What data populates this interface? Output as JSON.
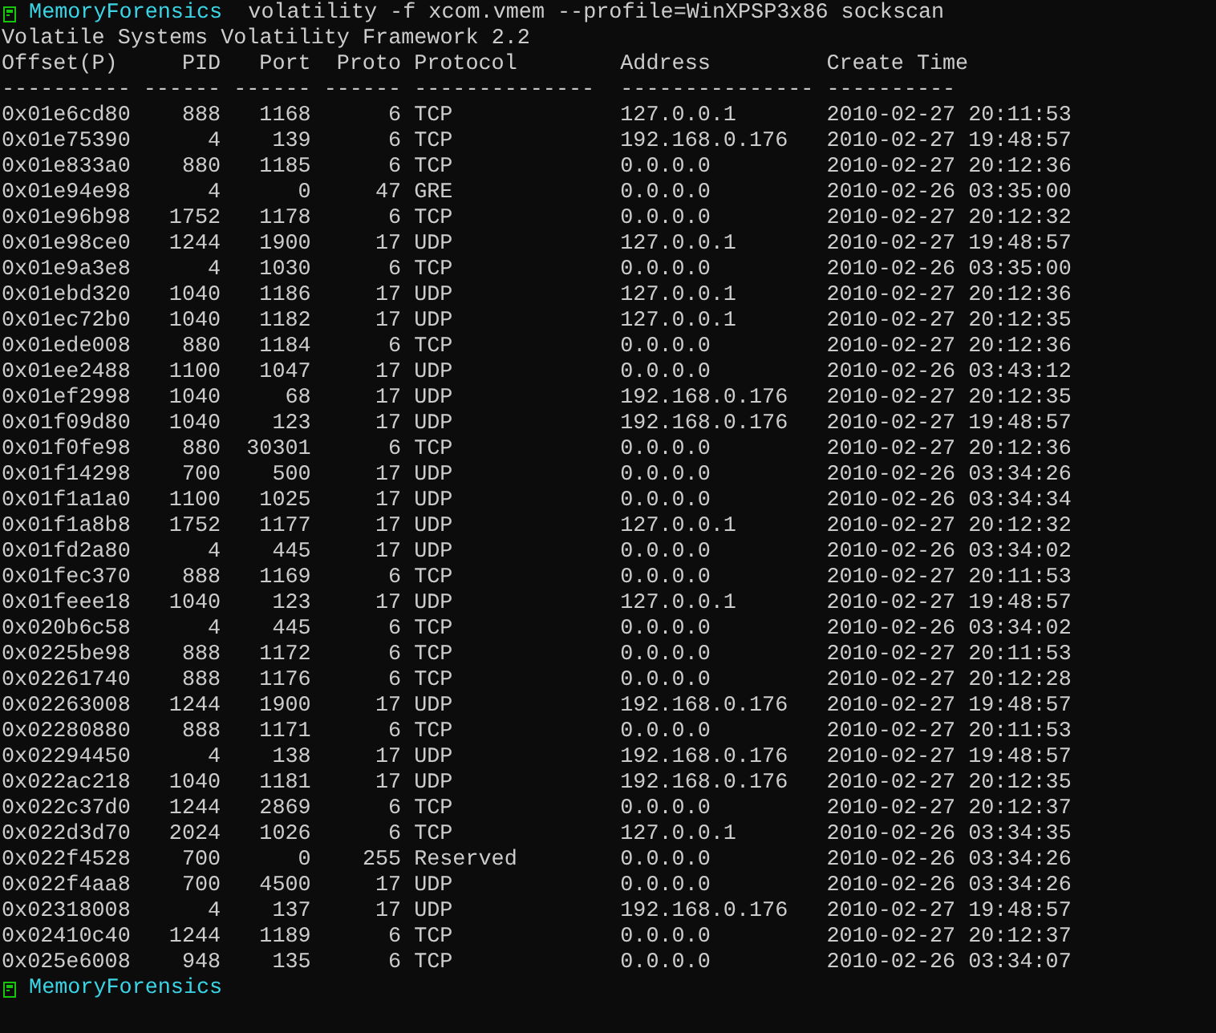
{
  "prompt": {
    "host": "MemoryForensics",
    "command": "volatility -f xcom.vmem --profile=WinXPSP3x86 sockscan"
  },
  "banner": "Volatile Systems Volatility Framework 2.2",
  "columns": [
    "Offset(P)",
    "PID",
    "Port",
    "Proto",
    "Protocol",
    "Address",
    "Create Time"
  ],
  "separator": [
    "----------",
    "------",
    "------",
    "------",
    "--------------",
    "---------------",
    "----------"
  ],
  "rows": [
    [
      "0x01e6cd80",
      "888",
      "1168",
      "6",
      "TCP",
      "127.0.0.1",
      "2010-02-27 20:11:53"
    ],
    [
      "0x01e75390",
      "4",
      "139",
      "6",
      "TCP",
      "192.168.0.176",
      "2010-02-27 19:48:57"
    ],
    [
      "0x01e833a0",
      "880",
      "1185",
      "6",
      "TCP",
      "0.0.0.0",
      "2010-02-27 20:12:36"
    ],
    [
      "0x01e94e98",
      "4",
      "0",
      "47",
      "GRE",
      "0.0.0.0",
      "2010-02-26 03:35:00"
    ],
    [
      "0x01e96b98",
      "1752",
      "1178",
      "6",
      "TCP",
      "0.0.0.0",
      "2010-02-27 20:12:32"
    ],
    [
      "0x01e98ce0",
      "1244",
      "1900",
      "17",
      "UDP",
      "127.0.0.1",
      "2010-02-27 19:48:57"
    ],
    [
      "0x01e9a3e8",
      "4",
      "1030",
      "6",
      "TCP",
      "0.0.0.0",
      "2010-02-26 03:35:00"
    ],
    [
      "0x01ebd320",
      "1040",
      "1186",
      "17",
      "UDP",
      "127.0.0.1",
      "2010-02-27 20:12:36"
    ],
    [
      "0x01ec72b0",
      "1040",
      "1182",
      "17",
      "UDP",
      "127.0.0.1",
      "2010-02-27 20:12:35"
    ],
    [
      "0x01ede008",
      "880",
      "1184",
      "6",
      "TCP",
      "0.0.0.0",
      "2010-02-27 20:12:36"
    ],
    [
      "0x01ee2488",
      "1100",
      "1047",
      "17",
      "UDP",
      "0.0.0.0",
      "2010-02-26 03:43:12"
    ],
    [
      "0x01ef2998",
      "1040",
      "68",
      "17",
      "UDP",
      "192.168.0.176",
      "2010-02-27 20:12:35"
    ],
    [
      "0x01f09d80",
      "1040",
      "123",
      "17",
      "UDP",
      "192.168.0.176",
      "2010-02-27 19:48:57"
    ],
    [
      "0x01f0fe98",
      "880",
      "30301",
      "6",
      "TCP",
      "0.0.0.0",
      "2010-02-27 20:12:36"
    ],
    [
      "0x01f14298",
      "700",
      "500",
      "17",
      "UDP",
      "0.0.0.0",
      "2010-02-26 03:34:26"
    ],
    [
      "0x01f1a1a0",
      "1100",
      "1025",
      "17",
      "UDP",
      "0.0.0.0",
      "2010-02-26 03:34:34"
    ],
    [
      "0x01f1a8b8",
      "1752",
      "1177",
      "17",
      "UDP",
      "127.0.0.1",
      "2010-02-27 20:12:32"
    ],
    [
      "0x01fd2a80",
      "4",
      "445",
      "17",
      "UDP",
      "0.0.0.0",
      "2010-02-26 03:34:02"
    ],
    [
      "0x01fec370",
      "888",
      "1169",
      "6",
      "TCP",
      "0.0.0.0",
      "2010-02-27 20:11:53"
    ],
    [
      "0x01feee18",
      "1040",
      "123",
      "17",
      "UDP",
      "127.0.0.1",
      "2010-02-27 19:48:57"
    ],
    [
      "0x020b6c58",
      "4",
      "445",
      "6",
      "TCP",
      "0.0.0.0",
      "2010-02-26 03:34:02"
    ],
    [
      "0x0225be98",
      "888",
      "1172",
      "6",
      "TCP",
      "0.0.0.0",
      "2010-02-27 20:11:53"
    ],
    [
      "0x02261740",
      "888",
      "1176",
      "6",
      "TCP",
      "0.0.0.0",
      "2010-02-27 20:12:28"
    ],
    [
      "0x02263008",
      "1244",
      "1900",
      "17",
      "UDP",
      "192.168.0.176",
      "2010-02-27 19:48:57"
    ],
    [
      "0x02280880",
      "888",
      "1171",
      "6",
      "TCP",
      "0.0.0.0",
      "2010-02-27 20:11:53"
    ],
    [
      "0x02294450",
      "4",
      "138",
      "17",
      "UDP",
      "192.168.0.176",
      "2010-02-27 19:48:57"
    ],
    [
      "0x022ac218",
      "1040",
      "1181",
      "17",
      "UDP",
      "192.168.0.176",
      "2010-02-27 20:12:35"
    ],
    [
      "0x022c37d0",
      "1244",
      "2869",
      "6",
      "TCP",
      "0.0.0.0",
      "2010-02-27 20:12:37"
    ],
    [
      "0x022d3d70",
      "2024",
      "1026",
      "6",
      "TCP",
      "127.0.0.1",
      "2010-02-26 03:34:35"
    ],
    [
      "0x022f4528",
      "700",
      "0",
      "255",
      "Reserved",
      "0.0.0.0",
      "2010-02-26 03:34:26"
    ],
    [
      "0x022f4aa8",
      "700",
      "4500",
      "17",
      "UDP",
      "0.0.0.0",
      "2010-02-26 03:34:26"
    ],
    [
      "0x02318008",
      "4",
      "137",
      "17",
      "UDP",
      "192.168.0.176",
      "2010-02-27 19:48:57"
    ],
    [
      "0x02410c40",
      "1244",
      "1189",
      "6",
      "TCP",
      "0.0.0.0",
      "2010-02-27 20:12:37"
    ],
    [
      "0x025e6008",
      "948",
      "135",
      "6",
      "TCP",
      "0.0.0.0",
      "2010-02-26 03:34:07"
    ]
  ],
  "final_prompt": {
    "host": "MemoryForensics"
  }
}
